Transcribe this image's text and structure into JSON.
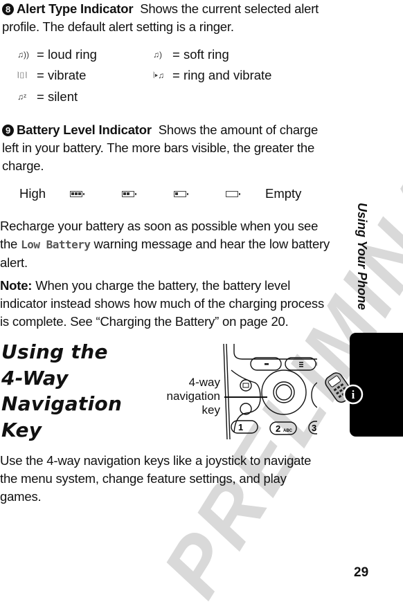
{
  "section8": {
    "number": "8",
    "title": "Alert Type Indicator",
    "text": "Shows the current selected alert profile. The default alert setting is a ringer."
  },
  "alert_legend": [
    {
      "icon": "loud-ring-icon",
      "glyph": "♫))",
      "label": "= loud ring"
    },
    {
      "icon": "soft-ring-icon",
      "glyph": "♫)",
      "label": "= soft ring"
    },
    {
      "icon": "vibrate-icon",
      "glyph": "⦚▯⦚",
      "label": "= vibrate"
    },
    {
      "icon": "ring-and-vibrate-icon",
      "glyph": "⦚▸♫",
      "label": "= ring and vibrate"
    },
    {
      "icon": "silent-icon",
      "glyph": "♫ᶻ",
      "label": "= silent"
    }
  ],
  "section9": {
    "number": "9",
    "title": "Battery Level Indicator",
    "text": "Shows the amount of charge left in your battery. The more bars visible, the greater the charge."
  },
  "battery_scale": {
    "high_label": "High",
    "empty_label": "Empty",
    "levels_bars": [
      3,
      2,
      1,
      0
    ]
  },
  "recharge": {
    "before": "Recharge your battery as soon as possible when you see the ",
    "lcd_text": "Low Battery",
    "after": " warning message and hear the low battery alert."
  },
  "note": {
    "label": "Note:",
    "text": "When you charge the battery, the battery level indicator instead shows how much of the charging process is complete. See “Charging the Battery” on page 20."
  },
  "nav_section": {
    "heading_lines": [
      "Using the",
      "4-Way",
      "Navigation",
      "Key"
    ],
    "callout_lines": [
      "4-way",
      "navigation",
      "key"
    ],
    "phone_keys": [
      "1",
      "2 ABC",
      "3"
    ],
    "text": "Use the 4-way navigation keys like a joystick to navigate the menu system, change feature settings, and play games."
  },
  "side_tab": {
    "title": "Using Your Phone",
    "icon": "info-phone-icon"
  },
  "watermark": "PRELIMINARY",
  "page_number": "29"
}
